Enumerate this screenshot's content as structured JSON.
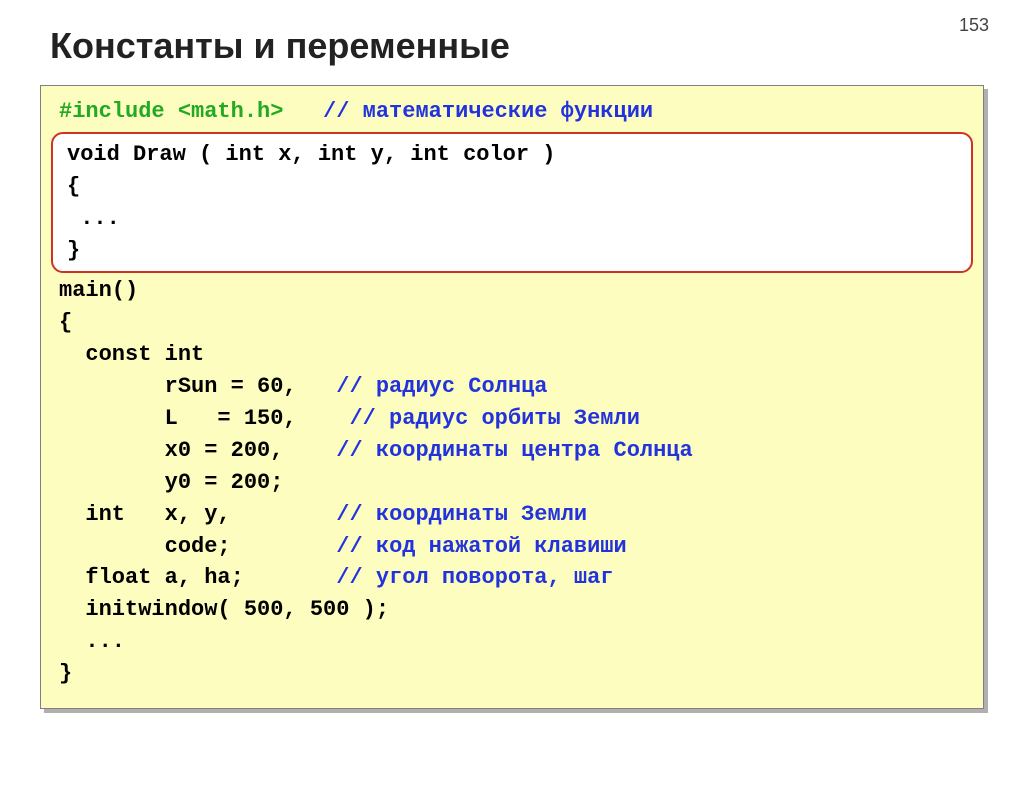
{
  "page_number": "153",
  "title": "Константы и переменные",
  "code": {
    "include": "#include <math.h>",
    "include_comment": "// математические функции",
    "draw_fn": "void Draw ( int x, int y, int color )\n{\n ...\n}",
    "main_line": "main()",
    "open_brace": "{",
    "const_int": "  const int",
    "rsun": "        rSun = 60,",
    "rsun_comment": "// радиус Солнца",
    "L": "        L   = 150,",
    "L_comment": "// радиус орбиты Земли",
    "x0": "        x0 = 200,",
    "x0_comment": "// координаты центра Солнца",
    "y0": "        y0 = 200;",
    "intxy": "  int   x, y,",
    "intxy_comment": "// координаты Земли",
    "code_var": "        code;",
    "code_var_comment": "// код нажатой клавиши",
    "floata": "  float a, ha;",
    "floata_comment": "// угол поворота, шаг",
    "initwindow": "  initwindow( 500, 500 );",
    "dots": "  ...",
    "close_brace": "}"
  }
}
